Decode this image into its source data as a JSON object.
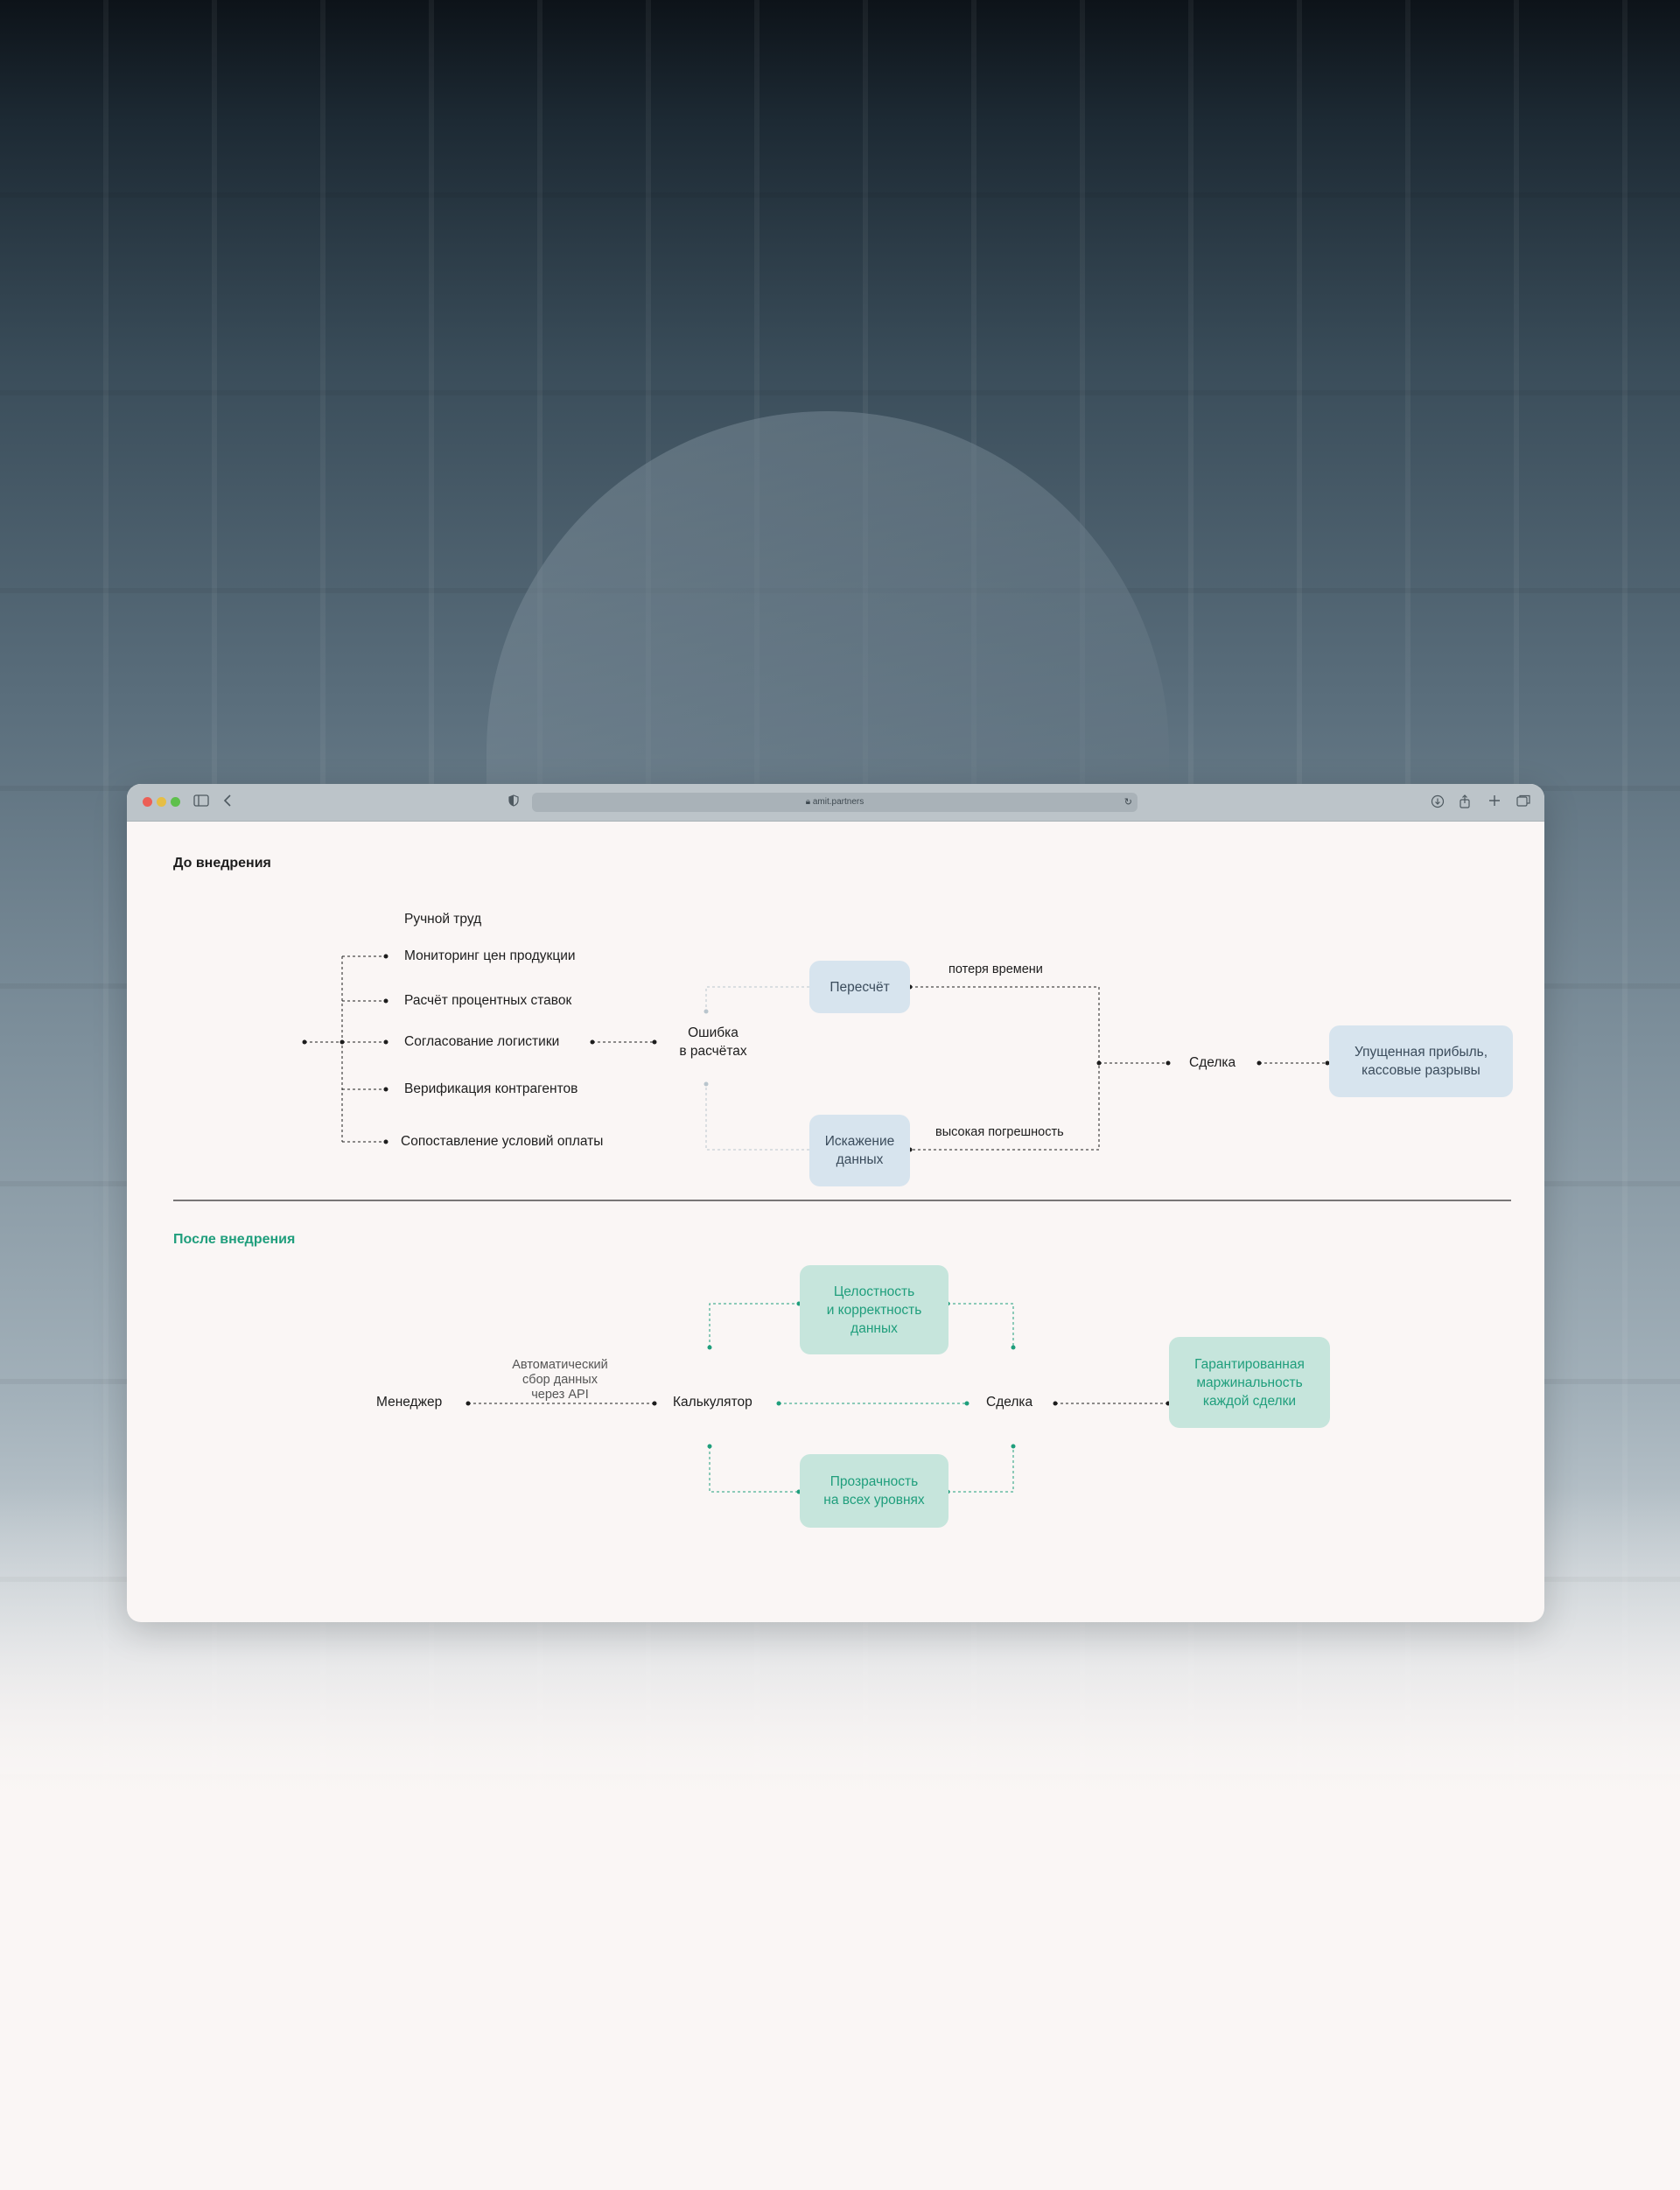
{
  "browser": {
    "url": "amit.partners"
  },
  "before": {
    "title": "До внедрения",
    "group_label": "Ручной труд",
    "tasks": [
      "Мониторинг цен продукции",
      "Расчёт процентных ставок",
      "Согласование логистики",
      "Верификация контрагентов",
      "Сопоставление условий оплаты"
    ],
    "error_node": "Ошибка\nв расчётах",
    "recalc_node": "Пересчёт",
    "distortion_node": "Искажение\nданных",
    "time_loss_label": "потеря времени",
    "inaccuracy_label": "высокая погрешность",
    "deal_node": "Сделка",
    "result_node": "Упущенная прибыль,\nкассовые разрывы"
  },
  "after": {
    "title": "После внедрения",
    "manager_node": "Менеджер",
    "api_label": "Автоматический\nсбор данных\nчерез API",
    "calculator_node": "Калькулятор",
    "integrity_node": "Целостность\nи корректность\nданных",
    "transparency_node": "Прозрачность\nна всех уровнях",
    "deal_node": "Сделка",
    "result_node": "Гарантированная\nмаржинальность\nкаждой сделки"
  },
  "colors": {
    "accent_green": "#1f9e7c",
    "node_blue": "#d7e4ee",
    "node_green": "#c6e5dc",
    "ink": "#1d1d1d"
  }
}
